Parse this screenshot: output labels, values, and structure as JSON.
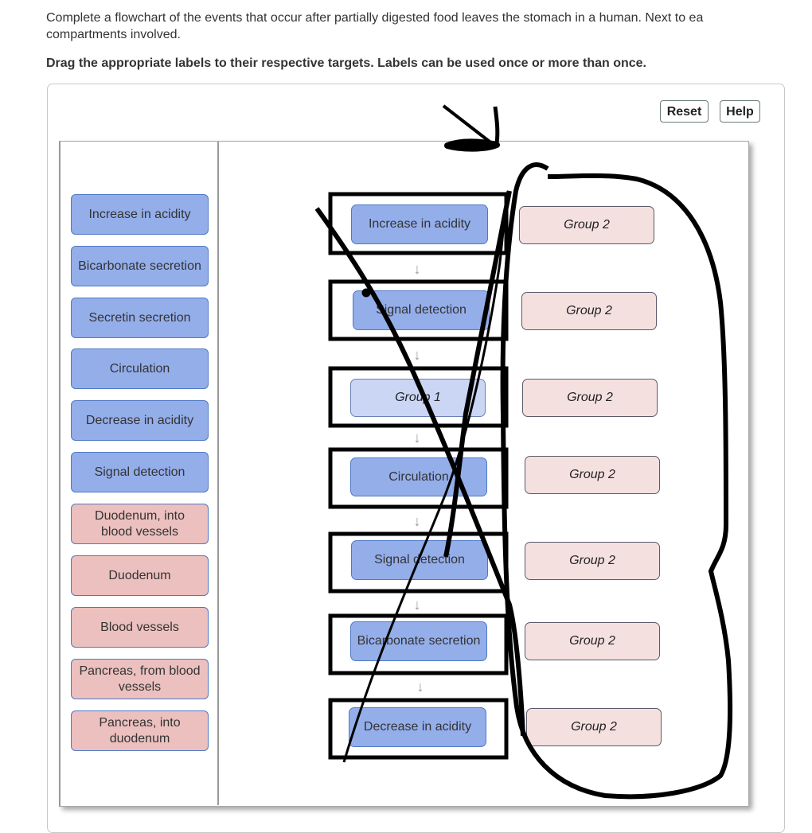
{
  "instructions": {
    "line1": "Complete a flowchart of the events that occur after partially digested food leaves the stomach in a human. Next to ea",
    "line2": "compartments involved.",
    "drag_instruction": "Drag the appropriate labels to their respective targets. Labels can be used once or more than once."
  },
  "toolbar": {
    "reset_label": "Reset",
    "help_label": "Help"
  },
  "label_bank": [
    {
      "text": "Increase in acidity",
      "color": "blue"
    },
    {
      "text": "Bicarbonate secretion",
      "color": "blue"
    },
    {
      "text": "Secretin secretion",
      "color": "blue"
    },
    {
      "text": "Circulation",
      "color": "blue"
    },
    {
      "text": "Decrease in acidity",
      "color": "blue"
    },
    {
      "text": "Signal detection",
      "color": "blue"
    },
    {
      "text": "Duodenum, into blood vessels",
      "color": "pink"
    },
    {
      "text": "Duodenum",
      "color": "pink"
    },
    {
      "text": "Blood vessels",
      "color": "pink"
    },
    {
      "text": "Pancreas, from blood vessels",
      "color": "pink"
    },
    {
      "text": "Pancreas, into duodenum",
      "color": "pink"
    }
  ],
  "flowchart": {
    "event_targets": [
      {
        "text": "Increase in acidity",
        "state": "filled"
      },
      {
        "text": "Signal detection",
        "state": "filled"
      },
      {
        "text": "Group 1",
        "state": "placeholder"
      },
      {
        "text": "Circulation",
        "state": "filled"
      },
      {
        "text": "Signal detection",
        "state": "filled"
      },
      {
        "text": "Bicarbonate secretion",
        "state": "filled"
      },
      {
        "text": "Decrease in acidity",
        "state": "filled"
      }
    ],
    "compartment_targets": [
      {
        "text": "Group 2"
      },
      {
        "text": "Group 2"
      },
      {
        "text": "Group 2"
      },
      {
        "text": "Group 2"
      },
      {
        "text": "Group 2"
      },
      {
        "text": "Group 2"
      },
      {
        "text": "Group 2"
      }
    ],
    "arrow_icon": "down-arrow-icon"
  },
  "colors": {
    "blue_label": "#94aeea",
    "pink_label": "#ebc0bf",
    "group1_placeholder": "#cbd6f4",
    "group2_placeholder": "#f5e0e0",
    "label_border": "#4f79c4"
  }
}
